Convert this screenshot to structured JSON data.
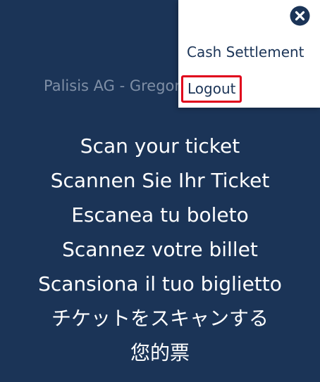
{
  "background_color": "#1b3457",
  "header": {
    "subtitle": "Palisis AG - Gregor"
  },
  "prompts": [
    "Scan your ticket",
    "Scannen Sie Ihr Ticket",
    "Escanea tu boleto",
    "Scannez votre billet",
    "Scansiona il tuo biglietto",
    "チケットをスキャンする",
    "您的票"
  ],
  "menu": {
    "close_icon": "close-circle-icon",
    "items": [
      {
        "label": "Cash Settlement"
      },
      {
        "label": "Logout",
        "highlighted": true,
        "highlight_color": "#e0001b"
      }
    ]
  }
}
